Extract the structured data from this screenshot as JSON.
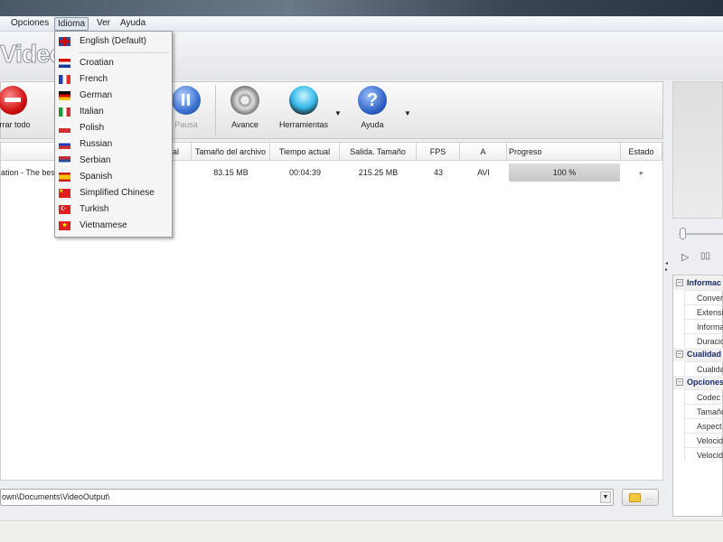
{
  "menu": {
    "items": [
      "Opciones",
      "Idioma",
      "Ver",
      "Ayuda"
    ]
  },
  "app": {
    "logo": "Video"
  },
  "toolbar": {
    "clear_all": "orrar todo",
    "pause": "Pausa",
    "preview": "Avance",
    "tools": "Herramientas",
    "help": "Ayuda"
  },
  "table": {
    "columns": [
      "al",
      "Tamaño del archivo",
      "Tiempo actual",
      "Salida. Tamaño",
      "FPS",
      "A",
      "Progreso",
      "Estado"
    ],
    "rows": [
      {
        "name": "ation - The best",
        "file_size": "83.15 MB",
        "current_time": "00:04:39",
        "output_size": "215.25 MB",
        "fps": "43",
        "format": "AVI",
        "progress_label": "100 %",
        "progress": 100
      }
    ]
  },
  "output": {
    "path": "own\\Documents\\VideoOutput\\",
    "browse": "..."
  },
  "language_menu": {
    "default": "English (Default)",
    "items": [
      "Croatian",
      "French",
      "German",
      "Italian",
      "Polish",
      "Russian",
      "Serbian",
      "Spanish",
      "Simplified Chinese",
      "Turkish",
      "Vietnamese"
    ]
  },
  "properties": {
    "categories": [
      {
        "name": "Informac",
        "rows": [
          "Convert",
          "Extensi",
          "Informa",
          "Duracio"
        ]
      },
      {
        "name": "Cualidad",
        "rows": [
          "Cualida"
        ]
      },
      {
        "name": "Opciones",
        "rows": [
          "Codec v",
          "Tamaño",
          "Aspect",
          "Velocid",
          "Velocid"
        ]
      }
    ]
  }
}
